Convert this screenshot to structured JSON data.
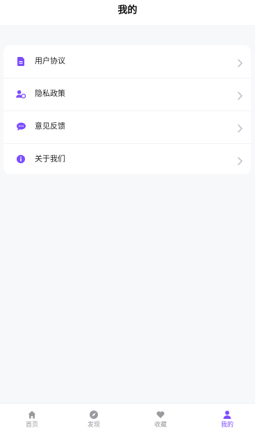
{
  "header": {
    "title": "我的"
  },
  "menu": {
    "items": [
      {
        "label": "用户协议",
        "icon": "document-icon"
      },
      {
        "label": "隐私政策",
        "icon": "user-shield-icon"
      },
      {
        "label": "意见反馈",
        "icon": "chat-bubble-icon"
      },
      {
        "label": "关于我们",
        "icon": "info-icon"
      }
    ]
  },
  "tabbar": {
    "tabs": [
      {
        "label": "首页",
        "icon": "home-icon",
        "active": false
      },
      {
        "label": "发现",
        "icon": "compass-icon",
        "active": false
      },
      {
        "label": "收藏",
        "icon": "heart-icon",
        "active": false
      },
      {
        "label": "我的",
        "icon": "user-icon",
        "active": true
      }
    ]
  },
  "colors": {
    "accent": "#7c4dff",
    "inactive": "#9a9aa0",
    "background": "#f7f8fa",
    "chevron": "#b7b7be"
  }
}
